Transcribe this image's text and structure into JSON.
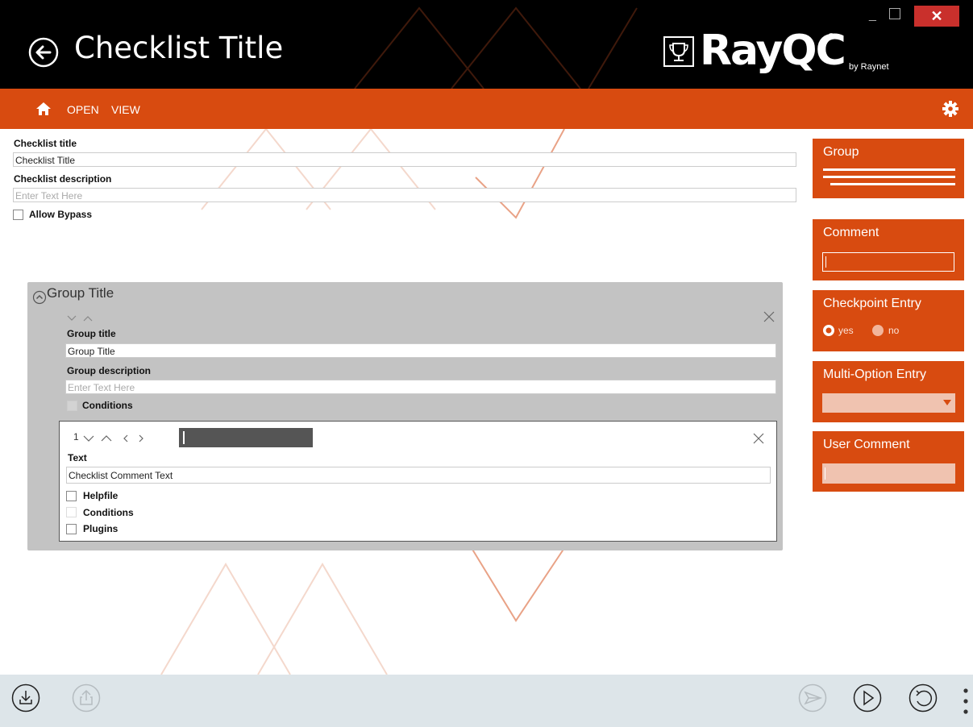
{
  "window": {
    "title": "Checklist Title",
    "close_glyph": "✕",
    "minimize_glyph": "_"
  },
  "brand": {
    "name": "RayQC",
    "registered": "®",
    "byline": "by Raynet"
  },
  "menu": {
    "open_label": "OPEN",
    "view_label": "VIEW"
  },
  "checklist": {
    "title_label": "Checklist title",
    "title_value": "Checklist Title",
    "description_label": "Checklist description",
    "description_placeholder": "Enter Text Here",
    "allow_bypass_label": "Allow Bypass"
  },
  "group": {
    "header_title": "Group Title",
    "title_label": "Group title",
    "title_value": "Group Title",
    "description_label": "Group description",
    "description_placeholder": "Enter Text Here",
    "conditions_label": "Conditions"
  },
  "item": {
    "index": "1",
    "text_label": "Text",
    "text_value": "Checklist Comment Text",
    "helpfile_label": "Helpfile",
    "conditions_label": "Conditions",
    "plugins_label": "Plugins"
  },
  "toolbox": {
    "group_label": "Group",
    "comment_label": "Comment",
    "checkpoint_label": "Checkpoint Entry",
    "checkpoint_yes": "yes",
    "checkpoint_no": "no",
    "multi_option_label": "Multi-Option Entry",
    "user_comment_label": "User Comment"
  },
  "colors": {
    "accent": "#d84b10",
    "titlebar": "#000000",
    "bottombar": "#dde5e9",
    "group_panel": "#c3c3c3"
  },
  "icons": [
    "back-arrow-icon",
    "trophy-icon",
    "home-icon",
    "gear-icon",
    "chevron-up-icon",
    "chevron-down-icon",
    "close-icon",
    "save-icon",
    "upload-icon",
    "send-icon",
    "play-icon",
    "undo-icon",
    "more-icon"
  ]
}
